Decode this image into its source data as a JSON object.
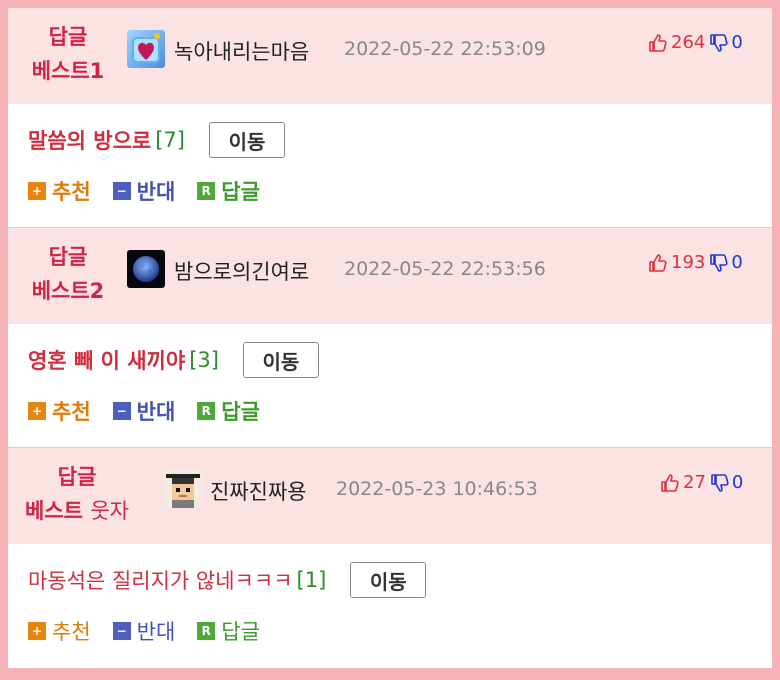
{
  "replies": [
    {
      "badge_top": "답글",
      "badge_bottom": "베스트1",
      "badge_suffix": "",
      "nickname": "녹아내리는마음",
      "date": "2022-05-22 22:53:09",
      "upvotes": "264",
      "downvotes": "0",
      "text": "말씀의 방으로",
      "comment_count": "[7]",
      "move_label": "이동",
      "avatar_icon": "melting-heart-avatar",
      "actions": {
        "recommend": "추천",
        "oppose": "반대",
        "reply": "답글"
      }
    },
    {
      "badge_top": "답글",
      "badge_bottom": "베스트2",
      "badge_suffix": "",
      "nickname": "밤으로의긴여로",
      "date": "2022-05-22 22:53:56",
      "upvotes": "193",
      "downvotes": "0",
      "text": "영혼 빼 이 새끼야",
      "comment_count": "[3]",
      "move_label": "이동",
      "avatar_icon": "night-moon-avatar",
      "actions": {
        "recommend": "추천",
        "oppose": "반대",
        "reply": "답글"
      }
    },
    {
      "badge_top": "답글",
      "badge_bottom": "베스트",
      "badge_suffix": "웃자",
      "nickname": "진짜진짜용",
      "date": "2022-05-23 10:46:53",
      "upvotes": "27",
      "downvotes": "0",
      "text": "마동석은 질리지가 않네ㅋㅋㅋ",
      "comment_count": "[1]",
      "move_label": "이동",
      "avatar_icon": "pixel-graduate-avatar",
      "actions": {
        "recommend": "추천",
        "oppose": "반대",
        "reply": "답글"
      }
    }
  ],
  "icons": {
    "recommend": "plus-icon",
    "oppose": "minus-icon",
    "reply": "reply-r-icon",
    "thumb_up": "thumb-up-icon",
    "thumb_down": "thumb-down-icon"
  },
  "colors": {
    "badge": "#cf2445",
    "header_bg": "#fbe3e4",
    "frame": "#f6b3b7",
    "recommend": "#e8850e",
    "oppose": "#4f5fbf",
    "reply": "#4ea83a",
    "upvote": "#e0303f",
    "downvote": "#1f37d8"
  }
}
